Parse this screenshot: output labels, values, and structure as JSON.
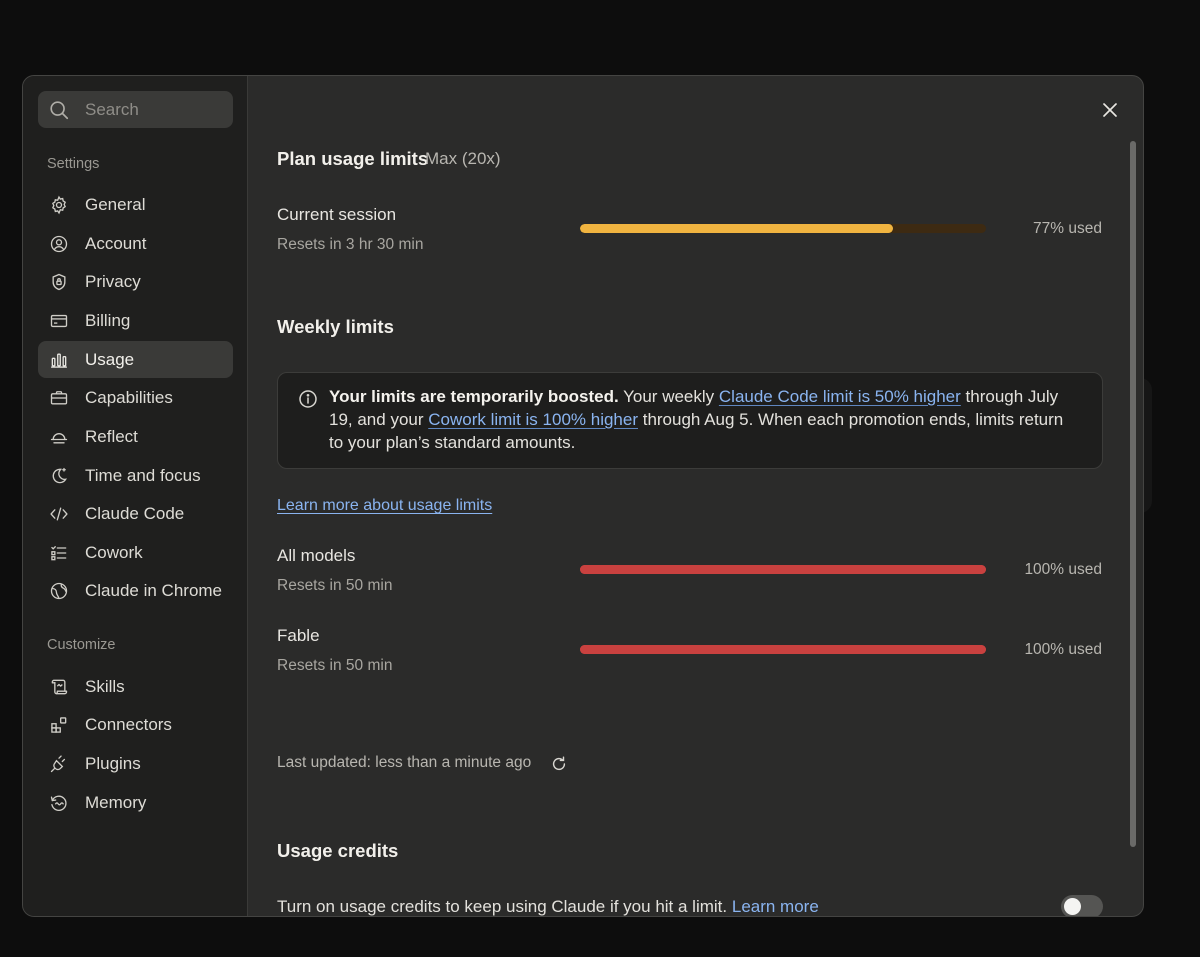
{
  "search": {
    "placeholder": "Search"
  },
  "sidebar": {
    "settings_label": "Settings",
    "settings_items": [
      {
        "label": "General",
        "icon": "gear-icon"
      },
      {
        "label": "Account",
        "icon": "user-circle-icon"
      },
      {
        "label": "Privacy",
        "icon": "shield-lock-icon"
      },
      {
        "label": "Billing",
        "icon": "credit-card-icon"
      },
      {
        "label": "Usage",
        "icon": "bar-chart-icon",
        "active": true
      },
      {
        "label": "Capabilities",
        "icon": "briefcase-icon"
      },
      {
        "label": "Reflect",
        "icon": "sunset-icon"
      },
      {
        "label": "Time and focus",
        "icon": "moon-icon"
      },
      {
        "label": "Claude Code",
        "icon": "code-icon"
      },
      {
        "label": "Cowork",
        "icon": "checklist-icon"
      },
      {
        "label": "Claude in Chrome",
        "icon": "globe-icon"
      }
    ],
    "customize_label": "Customize",
    "customize_items": [
      {
        "label": "Skills",
        "icon": "scroll-icon"
      },
      {
        "label": "Connectors",
        "icon": "blocks-icon"
      },
      {
        "label": "Plugins",
        "icon": "plug-icon"
      },
      {
        "label": "Memory",
        "icon": "memory-icon"
      }
    ]
  },
  "main": {
    "plan_title": "Plan usage limits",
    "plan_name": "Max (20x)",
    "current_session": {
      "title": "Current session",
      "reset": "Resets in 3 hr 30 min",
      "percent": 77,
      "used_text": "77% used",
      "color": "#f0b440",
      "track_color": "#3d2a12"
    },
    "weekly_title": "Weekly limits",
    "notice": {
      "bold": "Your limits are temporarily boosted.",
      "t1": " Your weekly ",
      "link1": "Claude Code limit is 50% higher",
      "t2": " through July 19, and your ",
      "link2": "Cowork limit is 100% higher",
      "t3": " through Aug 5. When each promotion ends, limits return to your plan’s standard amounts."
    },
    "learn_more_usage": "Learn more about usage limits",
    "all_models": {
      "title": "All models",
      "reset": "Resets in 50 min",
      "percent": 100,
      "used_text": "100% used",
      "color": "#c9413f"
    },
    "fable": {
      "title": "Fable",
      "reset": "Resets in 50 min",
      "percent": 100,
      "used_text": "100% used",
      "color": "#c9413f"
    },
    "last_updated": "Last updated: less than a minute ago",
    "credits_title": "Usage credits",
    "credits_text": "Turn on usage credits to keep using Claude if you hit a limit.",
    "credits_link": "Learn more",
    "credits_enabled": false
  }
}
